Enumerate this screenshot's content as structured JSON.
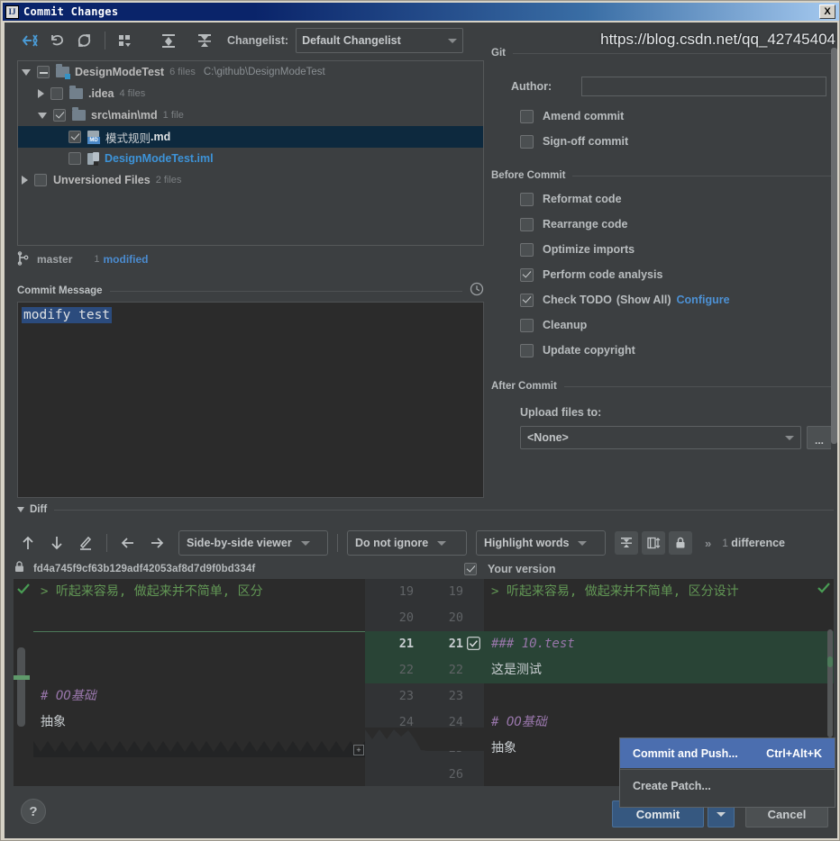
{
  "window": {
    "title": "Commit Changes",
    "icon": "intellij-idea-icon",
    "close_label": "X"
  },
  "toolbar": {
    "icons": [
      {
        "name": "collapse-to-selection-icon"
      },
      {
        "name": "rollback-icon"
      },
      {
        "name": "refresh-icon"
      },
      {
        "name": "group-by-icon"
      },
      {
        "name": "expand-all-icon"
      },
      {
        "name": "collapse-all-icon"
      }
    ],
    "changelist_label": "Changelist:",
    "changelist_value": "Default Changelist"
  },
  "tree": {
    "rows": [
      {
        "name": "DesignModeTest",
        "meta": "6 files",
        "path": "C:\\github\\DesignModeTest"
      },
      {
        "name": ".idea",
        "meta": "4 files"
      },
      {
        "name": "src\\main\\md",
        "meta": "1 file"
      },
      {
        "name_cn": "模式规则",
        "name_ext": ".md"
      },
      {
        "name": "DesignModeTest.iml"
      },
      {
        "name": "Unversioned Files",
        "meta": "2 files"
      }
    ]
  },
  "branch": {
    "name": "master",
    "count": "1",
    "status": "modified"
  },
  "commit_message": {
    "section_title": "Commit Message",
    "history_icon": "clock-history-icon",
    "value": "modify test"
  },
  "git": {
    "section_title": "Git",
    "author_label": "Author:",
    "author_value": "",
    "options": [
      {
        "label": "Amend commit",
        "checked": false
      },
      {
        "label": "Sign-off commit",
        "checked": false
      }
    ]
  },
  "before_commit": {
    "section_title": "Before Commit",
    "options": [
      {
        "label": "Reformat code",
        "checked": false
      },
      {
        "label": "Rearrange code",
        "checked": false
      },
      {
        "label": "Optimize imports",
        "checked": false
      },
      {
        "label": "Perform code analysis",
        "checked": true
      },
      {
        "label": "Check TODO",
        "checked": true,
        "suffix": "(Show All)",
        "link": "Configure"
      },
      {
        "label": "Cleanup",
        "checked": false
      },
      {
        "label": "Update copyright",
        "checked": false
      }
    ]
  },
  "after_commit": {
    "section_title": "After Commit",
    "upload_label": "Upload files to:",
    "upload_value": "<None>",
    "browse_label": "..."
  },
  "diff": {
    "section_title": "Diff",
    "toolbar_icons": [
      {
        "name": "previous-difference-icon"
      },
      {
        "name": "next-difference-icon"
      },
      {
        "name": "edit-source-icon"
      },
      {
        "name": "apply-left-icon"
      },
      {
        "name": "apply-right-icon"
      }
    ],
    "viewer_mode": "Side-by-side viewer",
    "ignore_mode": "Do not ignore",
    "highlight_mode": "Highlight words",
    "right_icons": [
      {
        "name": "collapse-unchanged-icon"
      },
      {
        "name": "synchronize-scrolling-icon"
      },
      {
        "name": "read-only-lock-icon"
      }
    ],
    "expand_chevrons": "»",
    "difference_count": "1",
    "difference_label": "difference",
    "left_header_hash": "fd4a745f9cf63b129adf42053af8d7d9f0bd334f",
    "left_header_icon": "lock-icon",
    "right_header_label": "Your version",
    "left_lines": [
      {
        "text": "> 听起来容易, 做起来并不简单, 区分",
        "style": "quote"
      },
      {
        "text": "",
        "style": "plain"
      },
      {
        "text": "",
        "style": "plain"
      },
      {
        "text": "",
        "style": "plain"
      },
      {
        "text": "# OO基础",
        "style": "head"
      },
      {
        "text": "抽象",
        "style": "plain"
      }
    ],
    "right_lines": [
      {
        "text": "> 听起来容易, 做起来并不简单, 区分设计",
        "style": "quote"
      },
      {
        "text": "",
        "style": "plain"
      },
      {
        "text": "### 10.test",
        "style": "head"
      },
      {
        "text": "这是测试",
        "style": "plain"
      },
      {
        "text": "",
        "style": "plain"
      },
      {
        "text": "# OO基础",
        "style": "head"
      },
      {
        "text": "抽象",
        "style": "plain"
      }
    ],
    "left_numbers": [
      "19",
      "20",
      "21",
      "22",
      "23",
      "24"
    ],
    "right_numbers": [
      "19",
      "20",
      "21",
      "22",
      "23",
      "24",
      "25",
      "26"
    ]
  },
  "context_menu": {
    "items": [
      {
        "label": "Commit and Push...",
        "shortcut": "Ctrl+Alt+K",
        "selected": true
      },
      {
        "label": "Create Patch...",
        "shortcut": "",
        "selected": false
      }
    ]
  },
  "footer": {
    "help_label": "?",
    "commit_label": "Commit",
    "cancel_label": "Cancel"
  },
  "watermark": {
    "text": "https://blog.csdn.net/qq_42745404"
  },
  "colors": {
    "accent": "#4b6eaf",
    "link": "#4d91d4",
    "added": "#294436",
    "panel": "#3c3f41",
    "editor": "#2b2b2b"
  }
}
